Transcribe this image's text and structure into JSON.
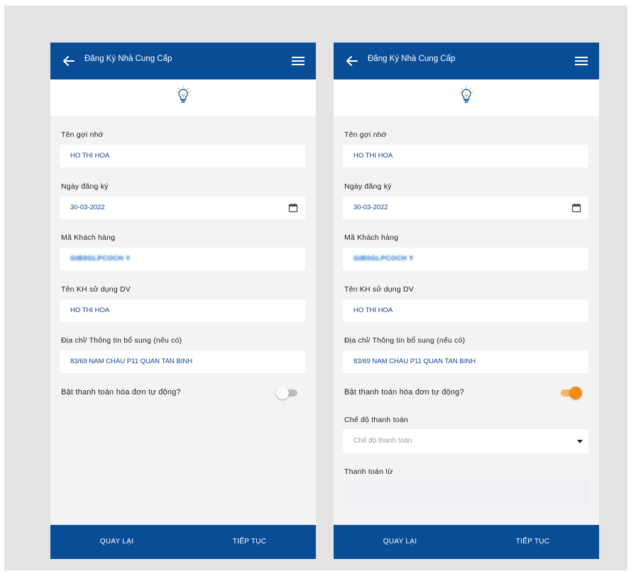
{
  "header": {
    "title": "Đăng Ký Nhà Cung Cấp"
  },
  "form": {
    "nickname_label": "Tên gợi nhớ",
    "nickname_value": "HO THI HOA",
    "reg_date_label": "Ngày đăng ký",
    "reg_date_value": "30-03-2022",
    "customer_code_label": "Mã Khách hàng",
    "customer_code_value": "GIB0GLPCOCH Y",
    "service_user_label": "Tên KH sử dụng DV",
    "service_user_value": "HO THI HOA",
    "address_label": "Địa chỉ/ Thông tin bổ sung (nếu có)",
    "address_value": "83/69 NAM CHAU P11 QUAN TAN BINH",
    "autopay_label": "Bật thanh toán hóa đơn tự động?"
  },
  "screens": [
    {
      "autopay_enabled": false
    },
    {
      "autopay_enabled": true,
      "payment_mode_label": "Chế độ thanh toán",
      "payment_mode_placeholder": "Chế độ thanh toán",
      "pay_from_label": "Thanh toán từ"
    }
  ],
  "footer": {
    "back_label": "QUAY LẠI",
    "next_label": "TIẾP TỤC"
  },
  "colors": {
    "primary": "#0a4d97",
    "accent": "#f28c12",
    "background": "#f3f3f3"
  },
  "icons": {
    "back": "arrow-left-icon",
    "menu": "hamburger-menu-icon",
    "logo": "light-bulb-icon",
    "calendar": "calendar-icon",
    "dropdown": "caret-down-icon"
  }
}
